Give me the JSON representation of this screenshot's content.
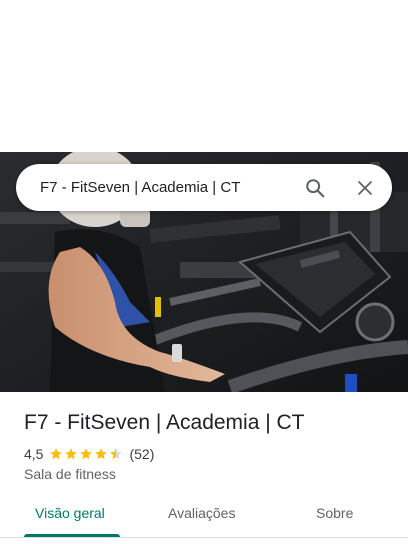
{
  "search": {
    "query": "F7 - FitSeven | Academia | CT",
    "search_icon": "search-icon",
    "close_icon": "close-icon"
  },
  "place": {
    "title": "F7 - FitSeven | Academia | CT",
    "rating": "4,5",
    "stars": 4.5,
    "reviews": "(52)",
    "category": "Sala de fitness",
    "photo_icon": "gym-photo"
  },
  "tabs": [
    {
      "label": "Visão geral",
      "active": true
    },
    {
      "label": "Avaliações",
      "active": false
    },
    {
      "label": "Sobre",
      "active": false
    }
  ],
  "colors": {
    "accent": "#00796b",
    "star": "#fbbc04",
    "text": "#202124",
    "secondary_text": "#5f6368"
  }
}
